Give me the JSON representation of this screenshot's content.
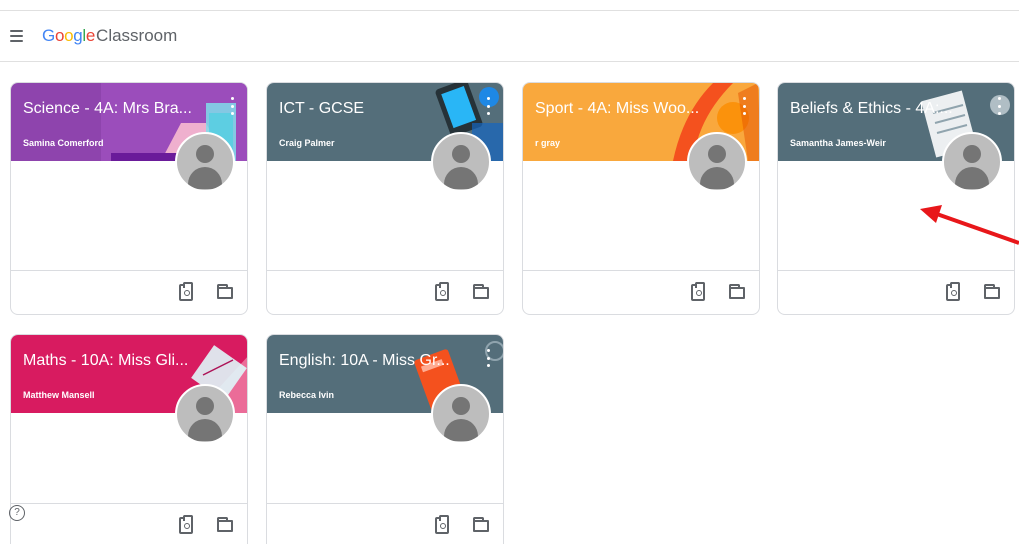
{
  "app": {
    "logo_google": "Google",
    "logo_product": "Classroom",
    "menu_icon": "hamburger-menu-icon",
    "help_label": "?"
  },
  "colors": {
    "logo_blue": "#4285f4",
    "logo_red": "#ea4335",
    "logo_yellow": "#fbbc05",
    "logo_green": "#34a853",
    "annotation_arrow": "#e8171a"
  },
  "courses": [
    {
      "title": "Science - 4A: Mrs Bra...",
      "teacher": "Samina Comerford",
      "color": "#8e44ad"
    },
    {
      "title": "ICT - GCSE",
      "teacher": "Craig Palmer",
      "color": "#546e7a"
    },
    {
      "title": "Sport - 4A: Miss Woo...",
      "teacher": "r gray",
      "color": "#f9a83d"
    },
    {
      "title": "Beliefs & Ethics - 4A:...",
      "teacher": "Samantha James-Weir",
      "color": "#546e7a"
    },
    {
      "title": "Maths - 10A: Miss Gli...",
      "teacher": "Matthew Mansell",
      "color": "#d81b60"
    },
    {
      "title": "English: 10A - Miss Gr...",
      "teacher": "Rebecca Ivin",
      "color": "#546e7a"
    }
  ],
  "footer_icons": [
    "assignment-icon",
    "folder-icon"
  ]
}
